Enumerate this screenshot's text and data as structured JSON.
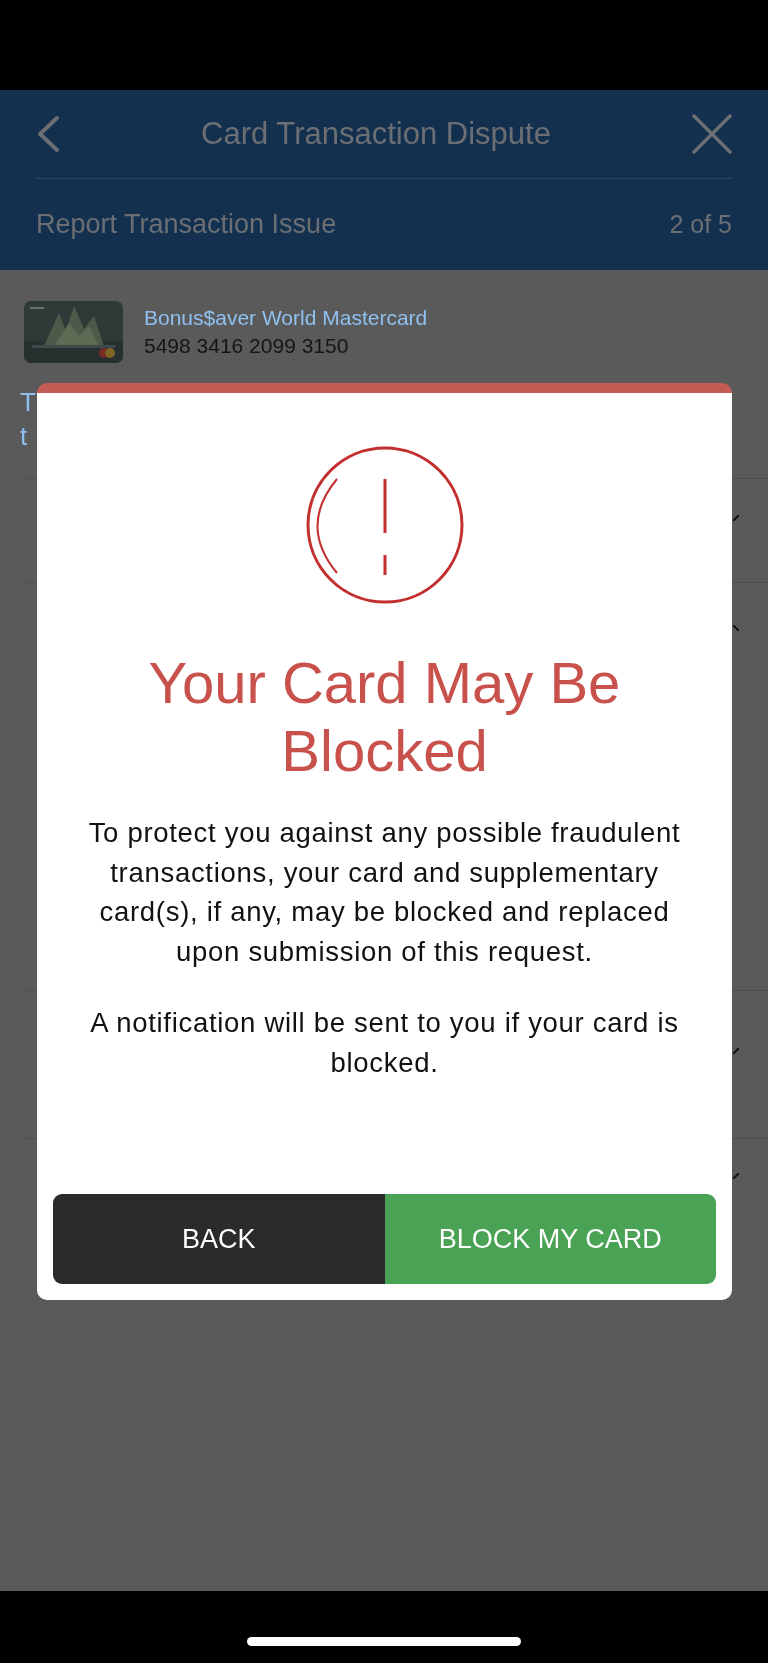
{
  "header": {
    "title": "Card Transaction Dispute",
    "step_title": "Report Transaction Issue",
    "step": "2 of 5"
  },
  "card": {
    "name": "Bonus$aver World Mastercard",
    "number": "5498 3416 2099 3150"
  },
  "heading_fragment_lines": [
    "T",
    "t"
  ],
  "dialog": {
    "title": "Your Card May Be Blocked",
    "paragraphs": [
      "To protect you against any possible fraudulent transactions, your card and supplementary card(s), if any, may be blocked and replaced upon submission of this request.",
      "A notification will be sent to you if your card is blocked."
    ],
    "buttons": [
      {
        "label": "BACK",
        "kind": "secondary"
      },
      {
        "label": "BLOCK MY CARD",
        "kind": "primary"
      }
    ]
  }
}
